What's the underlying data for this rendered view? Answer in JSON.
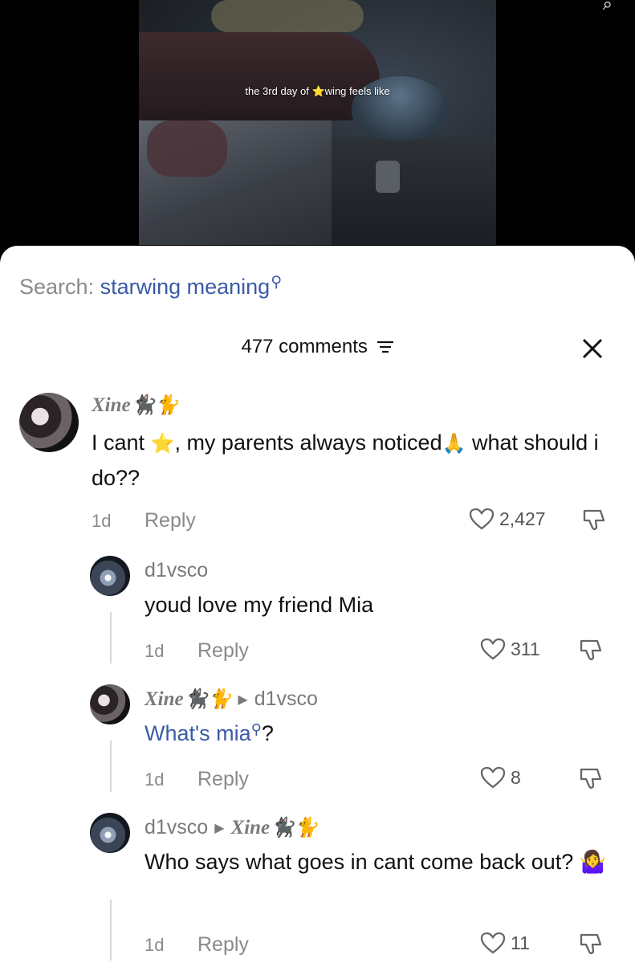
{
  "video": {
    "caption": "the 3rd day of ⭐wing feels like"
  },
  "search": {
    "label": "Search:",
    "term": "starwing meaning"
  },
  "header": {
    "count": "477 comments"
  },
  "comments": [
    {
      "name": "Xine",
      "name_emoji": "🐈‍⬛🐈",
      "text_parts": [
        "I cant ",
        "⭐",
        ", my parents always noticed",
        "🙏",
        " what should i do??"
      ],
      "age": "1d",
      "reply": "Reply",
      "likes": "2,427"
    },
    {
      "name": "d1vsco",
      "text": "youd love my friend Mia",
      "age": "1d",
      "reply": "Reply",
      "likes": "311"
    },
    {
      "name": "Xine",
      "name_emoji": "🐈‍⬛🐈",
      "reply_to": "d1vsco",
      "text_link": "What's mia",
      "text_suffix": "?",
      "age": "1d",
      "reply": "Reply",
      "likes": "8"
    },
    {
      "name": "d1vsco",
      "reply_to": "Xine",
      "reply_to_emoji": "🐈‍⬛🐈",
      "text": "Who says what goes in cant come back out? 🤷‍♀️",
      "age": "1d",
      "reply": "Reply",
      "likes": "11"
    }
  ]
}
